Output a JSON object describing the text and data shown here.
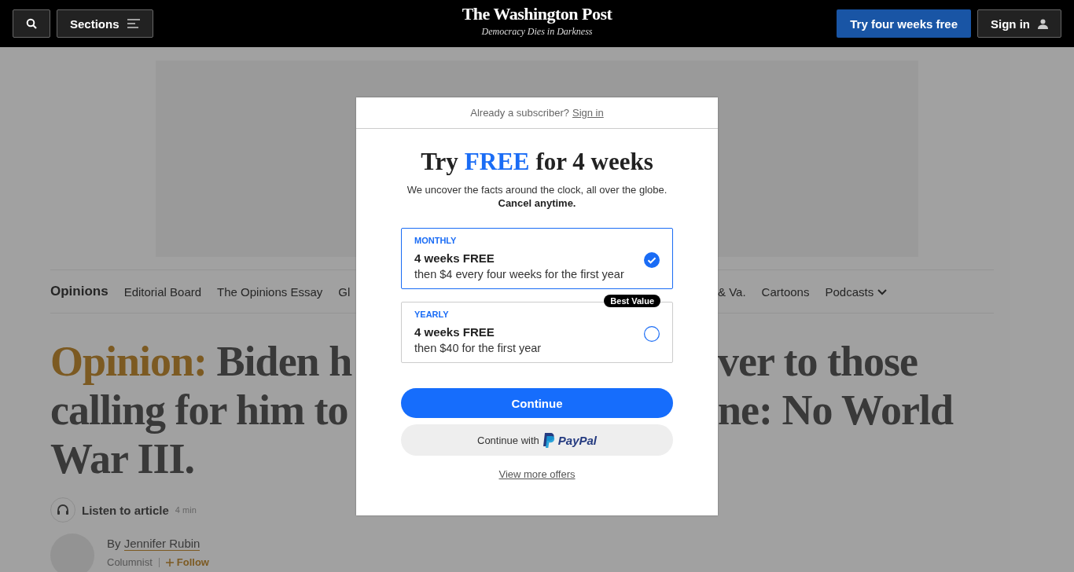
{
  "header": {
    "sections_label": "Sections",
    "logo": "The Washington Post",
    "tagline": "Democracy Dies in Darkness",
    "trial_button": "Try four weeks free",
    "sign_in_button": "Sign in"
  },
  "nav": {
    "left": [
      {
        "label": "Opinions",
        "selected": true
      },
      {
        "label": "Editorial Board",
        "selected": false
      },
      {
        "label": "The Opinions Essay",
        "selected": false
      },
      {
        "label": "Gl",
        "selected": false
      }
    ],
    "right": [
      {
        "label": "& Va.",
        "selected": false
      },
      {
        "label": "Cartoons",
        "selected": false
      },
      {
        "label": "Podcasts",
        "selected": false,
        "dropdown": true
      }
    ]
  },
  "headline": {
    "kicker": "Opinion:",
    "lines": [
      {
        "left": "Biden h",
        "right": "ver to those"
      },
      {
        "left": "calling for him to",
        "right": "ne: No World"
      },
      {
        "left": "War III."
      }
    ]
  },
  "listen": {
    "label": "Listen to article",
    "duration": "4 min"
  },
  "byline": {
    "prefix": "By",
    "author": "Jennifer Rubin",
    "role": "Columnist",
    "follow": "Follow"
  },
  "modal": {
    "subscriber_text": "Already a subscriber?",
    "sign_in_link": "Sign in",
    "title_parts": [
      {
        "text": "Try",
        "accent": false
      },
      {
        "text": "FREE",
        "accent": true
      },
      {
        "text": "for 4 weeks",
        "accent": false
      }
    ],
    "intro": "We uncover the facts around the clock, all over the globe.",
    "intro_bold": "Cancel anytime.",
    "plans": [
      {
        "period": "MONTHLY",
        "offer": "4 weeks FREE",
        "price": "then $4 every four weeks for the first year",
        "selected": true
      },
      {
        "period": "YEARLY",
        "offer": "4 weeks FREE",
        "price": "then $40 for the first year",
        "selected": false,
        "badge": "Best Value"
      }
    ],
    "continue_button": "Continue",
    "paypal_prefix": "Continue with",
    "paypal_brand": "PayPal",
    "more_offers": "View more offers"
  }
}
